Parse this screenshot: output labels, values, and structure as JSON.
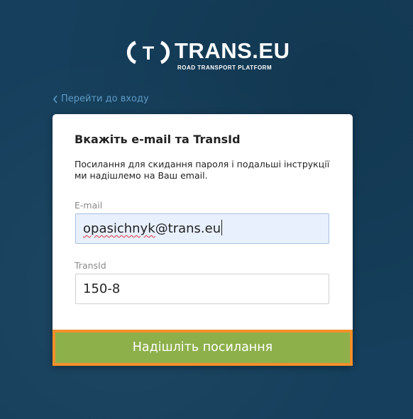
{
  "brand": {
    "name": "TRANS.EU",
    "tagline": "ROAD TRANSPORT PLATFORM",
    "mark_letter": "T"
  },
  "back_link": {
    "label": "Перейти до входу"
  },
  "card": {
    "title": "Вкажіть e-mail та TransId",
    "description": "Посилання для скидання пароля і подальші інструкції ми надішлемо на Ваш email.",
    "email": {
      "label": "E-mail",
      "value_user": "opasichnyk",
      "value_domain": "@trans.eu"
    },
    "transid": {
      "label": "TransId",
      "value": "150-8"
    },
    "submit_label": "Надішліть посилання"
  },
  "colors": {
    "background": "#153f5c",
    "link": "#5d9ac6",
    "button": "#8db04b",
    "button_outline": "#f39029",
    "input_focus_bg": "#e8f0fe"
  }
}
